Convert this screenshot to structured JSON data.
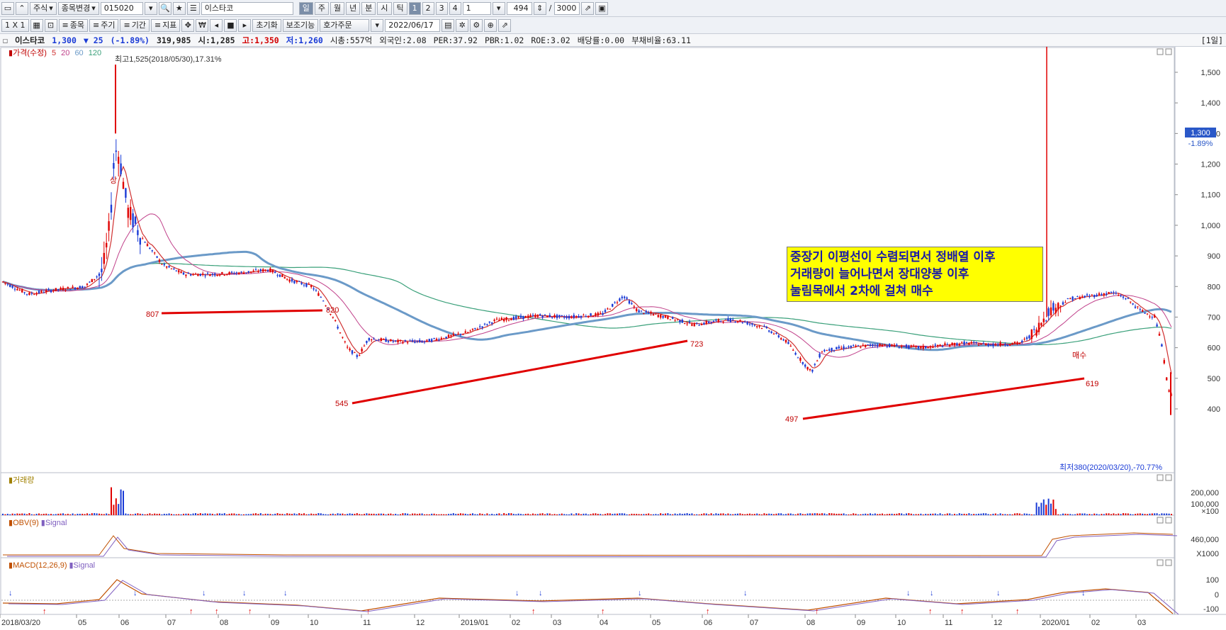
{
  "toolbar1": {
    "market": "주식",
    "change_item": "종목변경",
    "code": "015020",
    "stock_name": "이스타코",
    "period_tabs": [
      "일",
      "주",
      "월",
      "년",
      "분",
      "시",
      "틱"
    ],
    "count_tabs": [
      "1",
      "2",
      "3",
      "4"
    ],
    "interval_value": "1",
    "display_count": "494",
    "total_count": "3000"
  },
  "toolbar2": {
    "layout": "1 X 1",
    "btn_item": "종목",
    "btn_cycle": "주기",
    "btn_period": "기간",
    "btn_indicator": "지표",
    "btn_currency": "₩",
    "btn_reset": "초기화",
    "btn_aux": "보조기능",
    "btn_order": "호가주문",
    "date": "2022/06/17"
  },
  "infobar": {
    "name": "이스타코",
    "price": "1,300",
    "change": "▼ 25",
    "change_pct": "(-1.89%)",
    "volume": "319,985",
    "open": "시:1,285",
    "high": "고:1,350",
    "low": "저:1,260",
    "mktcap": "시총:557억",
    "foreign": "외국인:2.08",
    "per": "PER:37.92",
    "pbr": "PBR:1.02",
    "roe": "ROE:3.02",
    "dividend": "배당률:0.00",
    "debt": "부채비율:63.11",
    "period": "[1일]"
  },
  "price_pane": {
    "legend_title": "가격(수정)",
    "legend_ma": [
      "5",
      "20",
      "60",
      "120"
    ],
    "high_label": "최고1,525(2018/05/30),17.31%",
    "low_label": "최저380(2020/03/20),-70.77%",
    "current_price": "1,300",
    "current_pct": "-1.89%",
    "y_ticks": [
      "1,500",
      "1,400",
      "1,300",
      "1,200",
      "1,100",
      "1,000",
      "900",
      "800",
      "700",
      "600",
      "500",
      "400"
    ],
    "support_labels": [
      "807",
      "820",
      "545",
      "723",
      "497",
      "619"
    ],
    "marker_sang": "상",
    "marker_buy": "매수",
    "annotation": [
      "중장기 이평선이 수렴되면서 정배열 이후",
      "거래량이 늘어나면서 장대양봉 이후",
      "눌림목에서 2차에 걸쳐 매수"
    ]
  },
  "volume_pane": {
    "title": "거래량",
    "y_ticks": [
      "200,000",
      "100,000"
    ],
    "unit": "×100"
  },
  "obv_pane": {
    "title": "OBV(9)",
    "signal": "Signal",
    "y_tick": "460,000",
    "unit": "X1000"
  },
  "macd_pane": {
    "title": "MACD(12,26,9)",
    "signal": "Signal",
    "y_ticks": [
      "100",
      "0",
      "-100"
    ]
  },
  "x_axis": [
    "2018/03/20",
    "05",
    "06",
    "07",
    "08",
    "09",
    "10",
    "11",
    "12",
    "2019/01",
    "02",
    "03",
    "04",
    "05",
    "06",
    "07",
    "08",
    "09",
    "10",
    "11",
    "12",
    "2020/01",
    "02",
    "03"
  ],
  "colors": {
    "up": "#e00000",
    "down": "#1a3bd6",
    "ma5": "#d03030",
    "ma20": "#c0408a",
    "ma60": "#6b9ac8",
    "ma120": "#3aa07a",
    "annotation_bg": "#ffff00"
  }
}
